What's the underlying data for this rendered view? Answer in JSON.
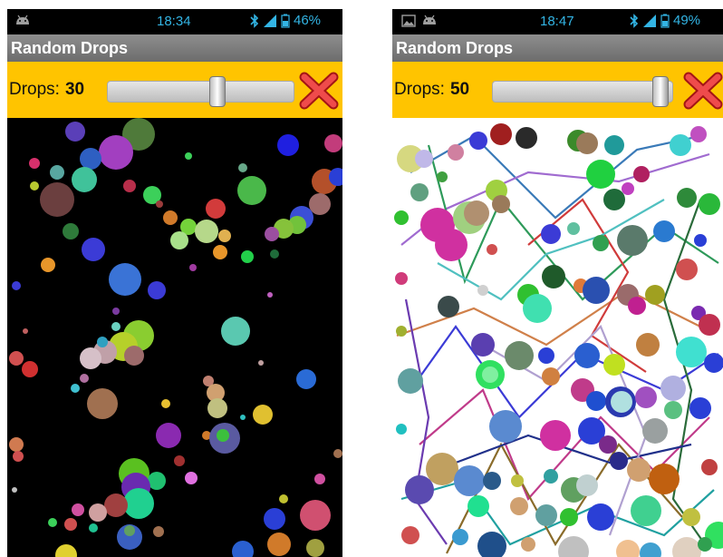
{
  "screens": [
    {
      "status": {
        "time": "18:34",
        "battery": "46%"
      },
      "title": "Random Drops",
      "drops_label": "Drops:",
      "drops_value": "30",
      "slider_level": 0.6,
      "canvas_background": "#000000"
    },
    {
      "status": {
        "time": "18:47",
        "battery": "49%"
      },
      "title": "Random Drops",
      "drops_label": "Drops:",
      "drops_value": "50",
      "slider_level": 0.98,
      "canvas_background": "#ffffff"
    }
  ],
  "icons": {
    "android": "android-icon",
    "gallery": "gallery-icon",
    "bluetooth": "bluetooth-icon",
    "signal": "signal-icon",
    "battery": "battery-icon",
    "close": "close-icon"
  },
  "colors": {
    "toolbar": "#ffc400",
    "title_bar": "#7a7a7a",
    "status_text": "#33b5e5",
    "close_red": "#e53935"
  }
}
